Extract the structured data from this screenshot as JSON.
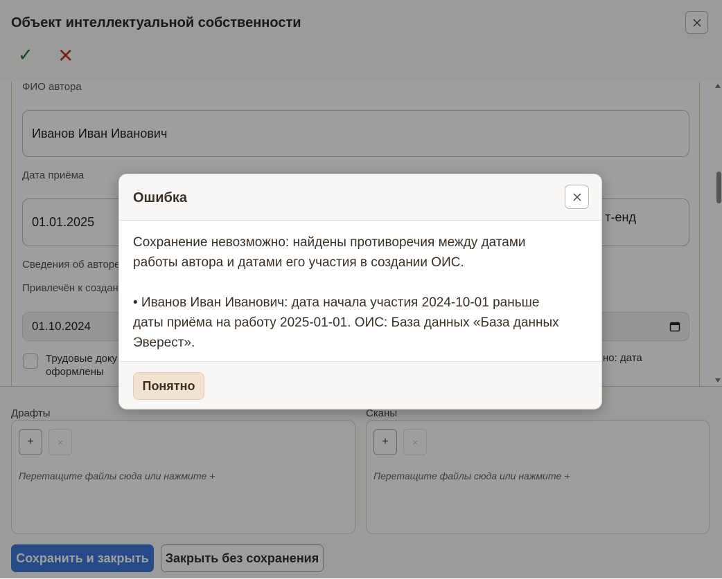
{
  "window": {
    "title": "Объект интеллектуальной собственности",
    "toolbar": {
      "ok_glyph": "✓",
      "cancel_glyph": "✕"
    }
  },
  "form": {
    "author_label": "ФИО автора",
    "author_value": "Иванов Иван Иванович",
    "hire_date_label": "Дата приёма",
    "hire_date_value": "01.01.2025",
    "right_field_partial": "т-енд",
    "author_info_label": "Сведения об авторе",
    "engaged_label": "Привлечён к создан",
    "engaged_date_value": "01.10.2024",
    "labor_docs_label_line1": "Трудовые доку",
    "labor_docs_label_line2": "оформлены",
    "right_note_partial": "но: дата"
  },
  "attachments": {
    "drafts_label": "Драфты",
    "scans_label": "Сканы",
    "add_glyph": "+",
    "remove_glyph": "×",
    "drop_hint": "Перетащите файлы сюда или нажмите +"
  },
  "footer": {
    "save_close": "Сохранить и закрыть",
    "close_no_save": "Закрыть без сохранения"
  },
  "dialog": {
    "title": "Ошибка",
    "message_line1": "Сохранение невозможно: найдены противоречия между датами",
    "message_line2": "работы автора и датами его участия в создании ОИС.",
    "detail_line1": "• Иванов Иван Иванович: дата начала участия 2024-10-01 раньше",
    "detail_line2": "даты приёма на работу 2025-01-01. ОИС: База данных «База данных",
    "detail_line3": "Эверест».",
    "ok_label": "Понятно"
  },
  "colors": {
    "primary": "#3d78d8",
    "ok_green": "#1f7a3a",
    "cancel_red": "#c0392b",
    "dialog_button": "#f2e2cf"
  }
}
